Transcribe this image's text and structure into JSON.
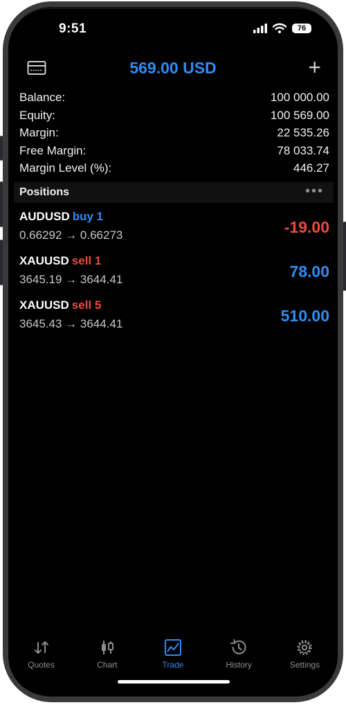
{
  "status_bar": {
    "time": "9:51",
    "battery": "76"
  },
  "header": {
    "title": "569.00 USD",
    "left_icon": "account-card-icon",
    "right_icon": "plus-icon"
  },
  "summary": [
    {
      "label": "Balance:",
      "value": "100 000.00"
    },
    {
      "label": "Equity:",
      "value": "100 569.00"
    },
    {
      "label": "Margin:",
      "value": "22 535.26"
    },
    {
      "label": "Free Margin:",
      "value": "78 033.74"
    },
    {
      "label": "Margin Level (%):",
      "value": "446.27"
    }
  ],
  "positions_header": {
    "label": "Positions",
    "more": "•••"
  },
  "positions": [
    {
      "symbol": "AUDUSD",
      "direction": "buy 1",
      "prices": "0.66292 → 0.66273",
      "pl": "-19.00",
      "dir_color": "#2f8df5",
      "pl_color": "#f04a3e"
    },
    {
      "symbol": "XAUUSD",
      "direction": "sell 1",
      "prices": "3645.19 → 3644.41",
      "pl": "78.00",
      "dir_color": "#f04a3e",
      "pl_color": "#2f8df5"
    },
    {
      "symbol": "XAUUSD",
      "direction": "sell 5",
      "prices": "3645.43 → 3644.41",
      "pl": "510.00",
      "dir_color": "#f04a3e",
      "pl_color": "#2f8df5"
    }
  ],
  "tabs": [
    {
      "label": "Quotes",
      "icon": "quotes-arrows-icon",
      "active": false
    },
    {
      "label": "Chart",
      "icon": "candlestick-icon",
      "active": false
    },
    {
      "label": "Trade",
      "icon": "trade-chart-icon",
      "active": true
    },
    {
      "label": "History",
      "icon": "history-clock-icon",
      "active": false
    },
    {
      "label": "Settings",
      "icon": "gear-icon",
      "active": false
    }
  ],
  "colors": {
    "accent": "#2f8df5",
    "negative": "#f04a3e",
    "background": "#000000"
  }
}
